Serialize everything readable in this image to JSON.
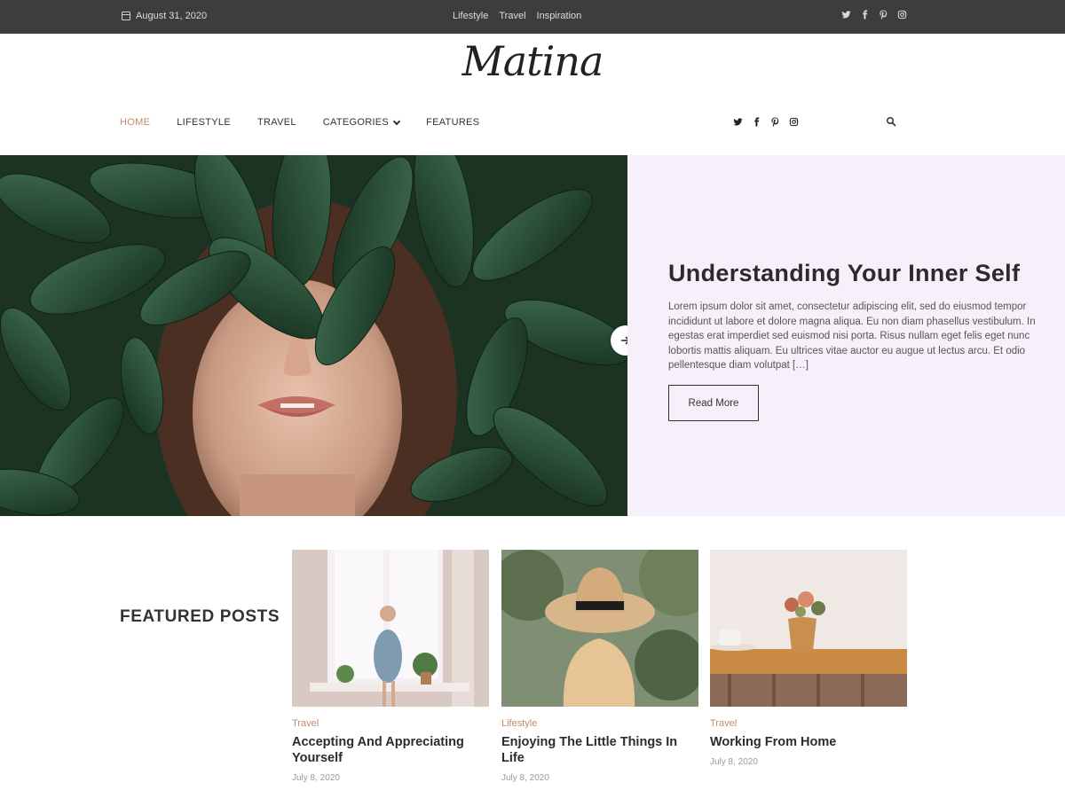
{
  "topbar": {
    "date": "August 31, 2020",
    "links": [
      "Lifestyle",
      "Travel",
      "Inspiration"
    ]
  },
  "logo": "Matina",
  "nav": {
    "items": [
      "HOME",
      "LIFESTYLE",
      "TRAVEL",
      "CATEGORIES",
      "FEATURES"
    ],
    "active": "HOME"
  },
  "social_icons": [
    "twitter-icon",
    "facebook-icon",
    "pinterest-icon",
    "instagram-icon"
  ],
  "hero": {
    "title": "Understanding Your Inner Self",
    "excerpt": "Lorem ipsum dolor sit amet, consectetur adipiscing elit, sed do eiusmod tempor incididunt ut labore et dolore magna aliqua. Eu non diam phasellus vestibulum. In egestas erat imperdiet sed euismod nisi porta. Risus nullam eget felis eget nunc lobortis mattis aliquam. Eu ultrices vitae auctor eu augue ut lectus arcu. Et odio pellentesque diam volutpat […]",
    "button": "Read More"
  },
  "featured": {
    "heading": "FEATURED POSTS",
    "posts": [
      {
        "category": "Travel",
        "title": "Accepting And Appreciating Yourself",
        "date": "July 8, 2020"
      },
      {
        "category": "Lifestyle",
        "title": "Enjoying The Little Things In Life",
        "date": "July 8, 2020"
      },
      {
        "category": "Travel",
        "title": "Working From Home",
        "date": "July 8, 2020"
      }
    ]
  },
  "colors": {
    "accent": "#c08a6e",
    "topbar_bg": "#3d3d3d",
    "hero_panel_bg": "#f7f0fb"
  }
}
